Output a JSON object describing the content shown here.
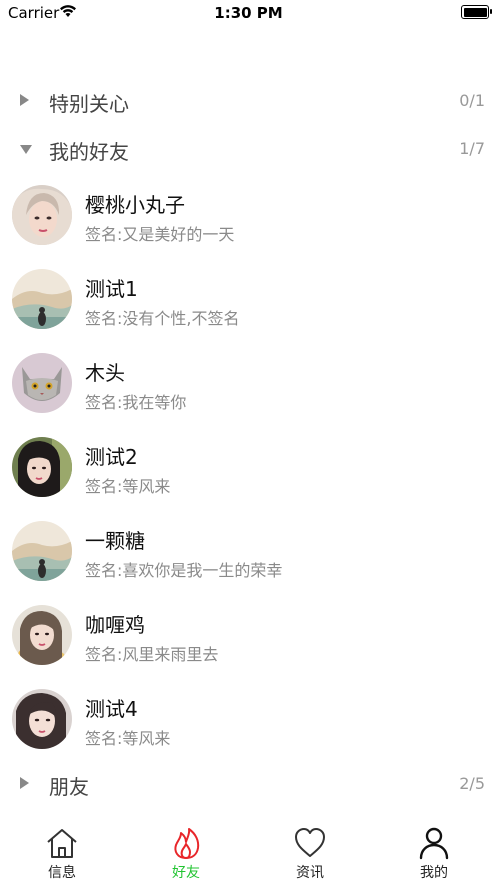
{
  "status_bar": {
    "carrier": "Carrier",
    "time": "1:30 PM"
  },
  "groups": [
    {
      "title": "特别关心",
      "count": "0/1",
      "expanded": false
    },
    {
      "title": "我的好友",
      "count": "1/7",
      "expanded": true
    },
    {
      "title": "朋友",
      "count": "2/5",
      "expanded": false
    }
  ],
  "friends": [
    {
      "name": "樱桃小丸子",
      "signature": "签名:又是美好的一天"
    },
    {
      "name": "测试1",
      "signature": "签名:没有个性,不签名"
    },
    {
      "name": "木头",
      "signature": "签名:我在等你"
    },
    {
      "name": "测试2",
      "signature": "签名:等风来"
    },
    {
      "name": "一颗糖",
      "signature": "签名:喜欢你是我一生的荣幸"
    },
    {
      "name": "咖喱鸡",
      "signature": "签名:风里来雨里去"
    },
    {
      "name": "测试4",
      "signature": "签名:等风来"
    }
  ],
  "tabs": [
    {
      "label": "信息",
      "icon": "home-icon",
      "active": false
    },
    {
      "label": "好友",
      "icon": "flame-icon",
      "active": true
    },
    {
      "label": "资讯",
      "icon": "heart-icon",
      "active": false
    },
    {
      "label": "我的",
      "icon": "person-icon",
      "active": false
    }
  ],
  "colors": {
    "active_tab": "#22c432",
    "flame": "#e8262a",
    "muted_text": "#8a8a8a"
  }
}
